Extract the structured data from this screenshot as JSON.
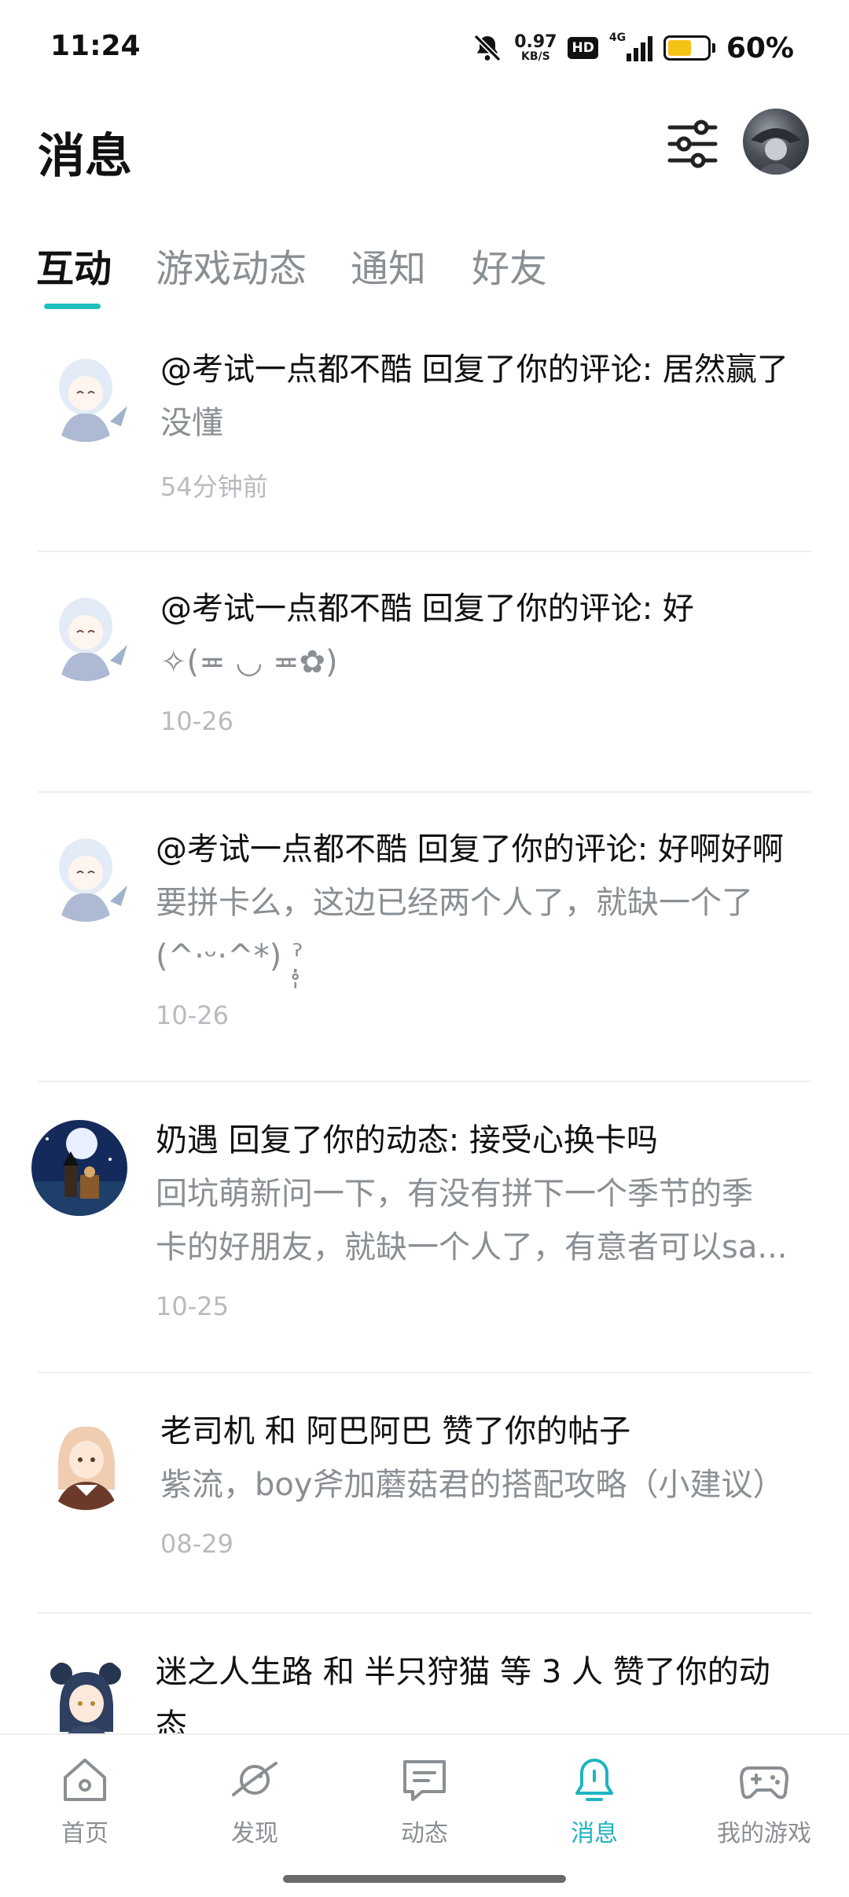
{
  "status": {
    "time": "11:24",
    "net_speed_value": "0.97",
    "net_speed_unit": "KB/S",
    "hd": "HD",
    "network": "4G",
    "battery_percent": "60%",
    "battery_level": 0.6
  },
  "header": {
    "title": "消息"
  },
  "tabs": [
    {
      "label": "互动",
      "active": true
    },
    {
      "label": "游戏动态",
      "active": false
    },
    {
      "label": "通知",
      "active": false
    },
    {
      "label": "好友",
      "active": false
    }
  ],
  "messages": [
    {
      "title": "@考试一点都不酷 回复了你的评论: 居然赢了",
      "lines": [
        "没懂"
      ],
      "time": "54分钟前",
      "avatar": "anime-girl-white-hair"
    },
    {
      "title": "@考试一点都不酷 回复了你的评论: 好",
      "lines": [
        "✧(≖ ◡ ≖✿)"
      ],
      "time": "10-26",
      "avatar": "anime-girl-white-hair"
    },
    {
      "title": "@考试一点都不酷 回复了你的评论: 好啊好啊",
      "lines": [
        "要拼卡么，这边已经两个人了，就缺一个了",
        "(^·ᵕ·^*) ˀ̣̥̩"
      ],
      "time": "10-26",
      "avatar": "anime-girl-white-hair"
    },
    {
      "title": "奶遇 回复了你的动态: 接受心换卡吗",
      "lines": [
        "回坑萌新问一下，有没有拼下一个季节的季",
        "卡的好朋友，就缺一个人了，有意者可以sa..."
      ],
      "time": "10-25",
      "avatar": "night-sky-characters"
    },
    {
      "title": "老司机 和 阿巴阿巴 赞了你的帖子",
      "lines": [
        "紫流，boy斧加蘑菇君的搭配攻略（小建议）"
      ],
      "time": "08-29",
      "avatar": "anime-girl-blonde"
    },
    {
      "title": "迷之人生路 和 半只狩猫 等 3 人 赞了你的动",
      "lines": [
        "态"
      ],
      "time": "",
      "avatar": "anime-girl-navy-hair"
    }
  ],
  "bottom_nav": [
    {
      "label": "首页",
      "icon": "home-icon",
      "active": false
    },
    {
      "label": "发现",
      "icon": "planet-icon",
      "active": false
    },
    {
      "label": "动态",
      "icon": "chat-bubble-icon",
      "active": false
    },
    {
      "label": "消息",
      "icon": "bell-icon",
      "active": true
    },
    {
      "label": "我的游戏",
      "icon": "gamepad-icon",
      "active": false
    }
  ],
  "colors": {
    "accent": "#1fbfbf",
    "nav_active": "#1fb4c0",
    "muted_text": "#8a8f94",
    "time_text": "#b7bbbf"
  }
}
